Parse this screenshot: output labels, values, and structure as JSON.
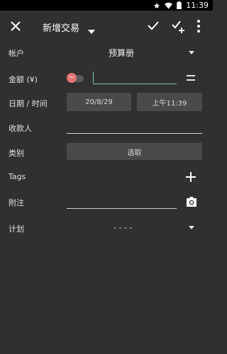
{
  "status": {
    "time": "11:39"
  },
  "appbar": {
    "title": "新增交易"
  },
  "account": {
    "label": "帐户",
    "value": "预算册"
  },
  "amount": {
    "label": "金额 (¥)",
    "sign": "−"
  },
  "datetime": {
    "label": "日期 / 时间",
    "date": "20/8/29",
    "time": "上午11:39"
  },
  "payee": {
    "label": "收款人"
  },
  "category": {
    "label": "类别",
    "button": "选取"
  },
  "tags": {
    "label": "Tags"
  },
  "note": {
    "label": "附注"
  },
  "plan": {
    "label": "计划",
    "value": "- - - -"
  },
  "colors": {
    "accent": "#7fc4c0",
    "negative": "#e57373",
    "background": "#303030"
  }
}
